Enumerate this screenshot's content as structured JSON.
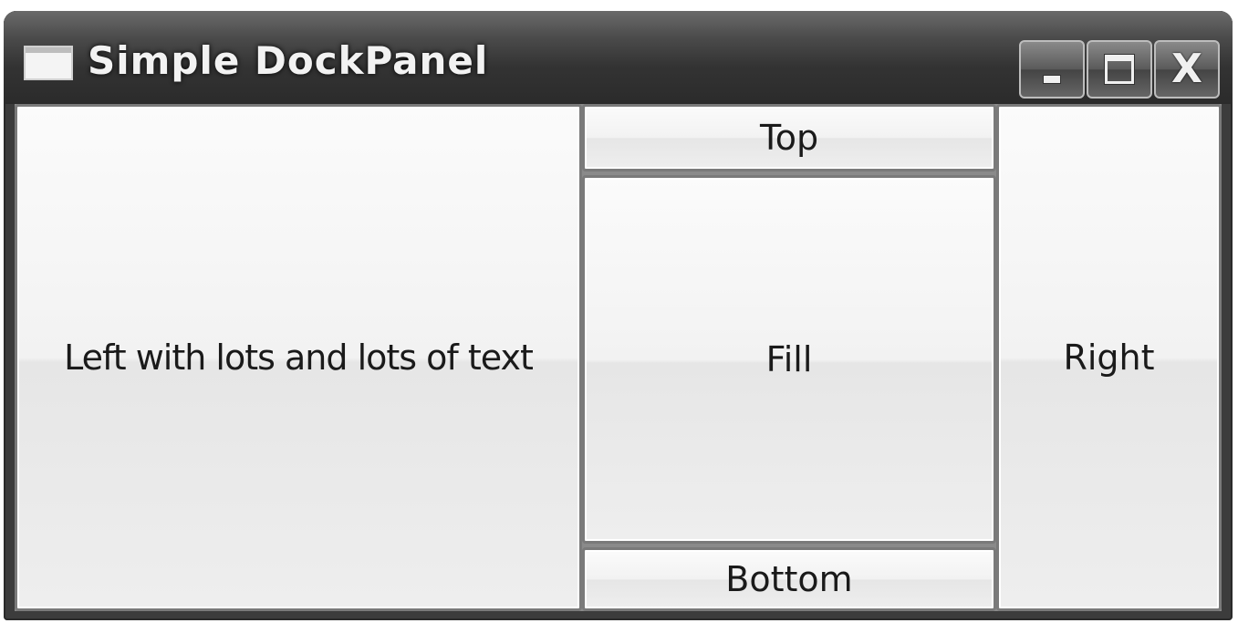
{
  "window": {
    "title": "Simple DockPanel",
    "app_icon": "window-icon",
    "caption_buttons": {
      "minimize_icon": "minimize-icon",
      "maximize_icon": "maximize-icon",
      "close_glyph": "X"
    }
  },
  "dock": {
    "left_label": "Left with lots and lots of text",
    "top_label": "Top",
    "fill_label": "Fill",
    "bottom_label": "Bottom",
    "right_label": "Right"
  },
  "colors": {
    "titlebar": "#333333",
    "button_face": "#f2f2f2",
    "button_border": "#7a7a7a",
    "text": "#1a1a1a"
  }
}
